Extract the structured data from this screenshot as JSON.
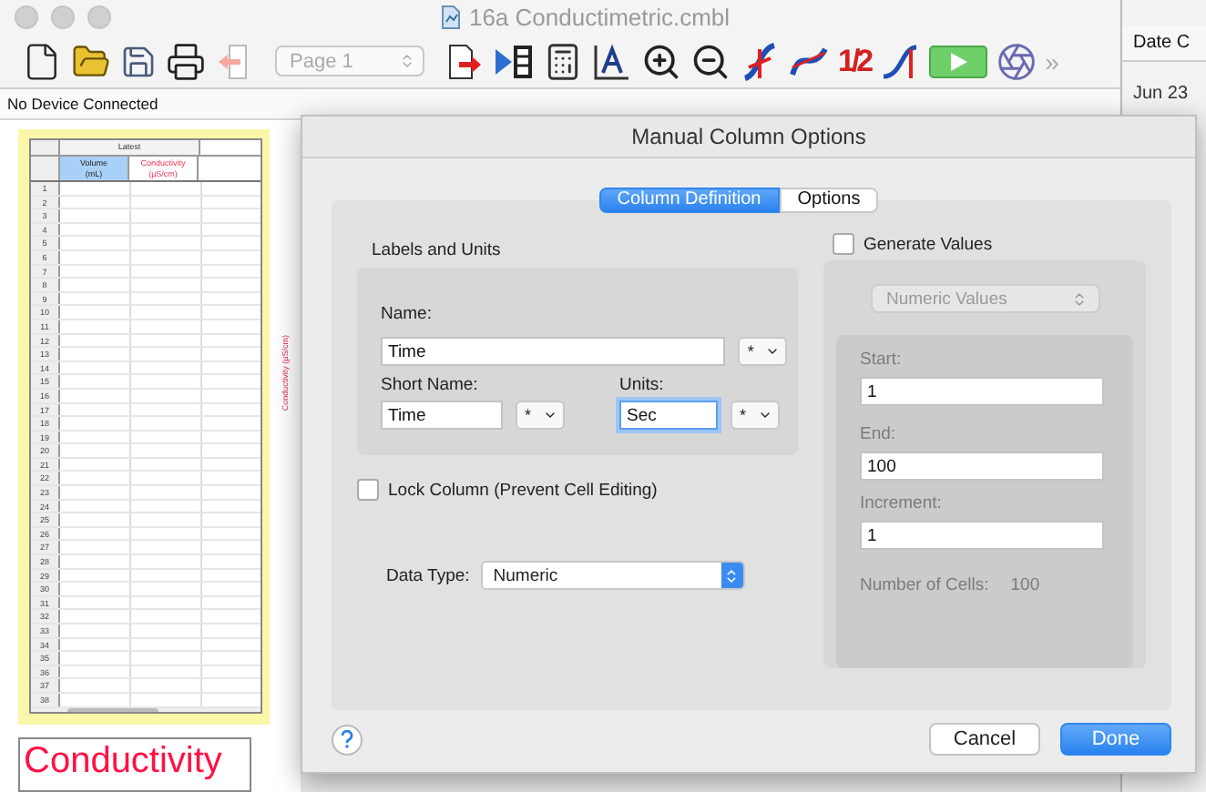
{
  "window": {
    "title": "16a Conductimetric.cmbl"
  },
  "toolbar": {
    "page_select": "Page 1",
    "half_label": "1/2",
    "overflow": "»"
  },
  "status": "No Device Connected",
  "background_list": {
    "header": "Date C",
    "rows": [
      "Jun 23"
    ]
  },
  "table": {
    "group_header": "Latest",
    "columns": [
      {
        "name": "Volume",
        "units": "(mL)",
        "selected": true,
        "kind": "manual"
      },
      {
        "name": "Conductivity",
        "units": "(µS/cm)",
        "selected": false,
        "kind": "sensor"
      }
    ],
    "row_numbers": [
      "1",
      "2",
      "3",
      "4",
      "5",
      "6",
      "7",
      "8",
      "9",
      "10",
      "11",
      "12",
      "13",
      "14",
      "15",
      "16",
      "17",
      "18",
      "19",
      "20",
      "21",
      "22",
      "23",
      "24",
      "25",
      "26",
      "27",
      "28",
      "29",
      "30",
      "31",
      "32",
      "33",
      "34",
      "35",
      "36",
      "37",
      "38"
    ]
  },
  "graph": {
    "y_axis_label": "Conductivity (µS/cm)"
  },
  "text_box": "Conductivity",
  "dialog": {
    "title": "Manual Column Options",
    "tabs": [
      {
        "label": "Column Definition",
        "selected": true
      },
      {
        "label": "Options",
        "selected": false
      }
    ],
    "labels_group": {
      "title": "Labels and Units",
      "name_label": "Name:",
      "name_value": "Time",
      "short_name_label": "Short Name:",
      "short_name_value": "Time",
      "units_label": "Units:",
      "units_value": "Sec",
      "units_focused": true,
      "symbol_menus": [
        "*",
        "*",
        "*"
      ]
    },
    "lock_column": {
      "label": "Lock Column (Prevent Cell Editing)",
      "checked": false
    },
    "data_type": {
      "label": "Data Type:",
      "value": "Numeric"
    },
    "generate": {
      "label": "Generate Values",
      "checked": false,
      "mode": "Numeric Values",
      "start_label": "Start:",
      "start_value": "1",
      "end_label": "End:",
      "end_value": "100",
      "increment_label": "Increment:",
      "increment_value": "1",
      "cells_label": "Number of Cells:",
      "cells_value": "100"
    },
    "buttons": [
      {
        "label": "Cancel",
        "kind": "secondary"
      },
      {
        "label": "Done",
        "kind": "primary"
      }
    ]
  }
}
